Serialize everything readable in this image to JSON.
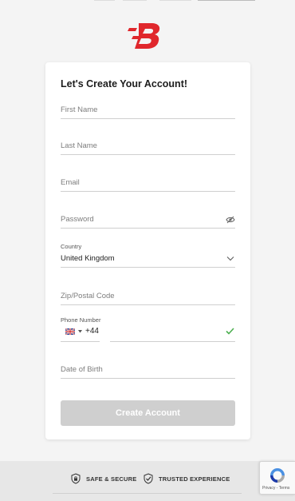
{
  "brand": {
    "logo_letter": "B",
    "color": "#e0272c"
  },
  "form": {
    "title": "Let's Create Your Account!",
    "first_name": {
      "placeholder": "First Name"
    },
    "last_name": {
      "placeholder": "Last Name"
    },
    "email": {
      "placeholder": "Email"
    },
    "password": {
      "placeholder": "Password",
      "icon": "eye-slash-icon"
    },
    "country": {
      "label": "Country",
      "value": "United Kingdom",
      "icon": "chevron-down-icon"
    },
    "zip": {
      "placeholder": "Zip/Postal Code"
    },
    "phone": {
      "label": "Phone Number",
      "flag": "uk-flag-icon",
      "dial_code": "+44",
      "valid_icon": "check-icon",
      "valid_color": "#4caf50"
    },
    "dob": {
      "placeholder": "Date of Birth"
    },
    "submit_label": "Create Account",
    "submit_color": "#cfcfcf"
  },
  "footer": {
    "badges": [
      {
        "icon": "lock-shield-icon",
        "label": "SAFE & SECURE"
      },
      {
        "icon": "check-shield-icon",
        "label": "TRUSTED EXPERIENCE"
      }
    ]
  },
  "recaptcha": {
    "links": "Privacy - Terms"
  }
}
